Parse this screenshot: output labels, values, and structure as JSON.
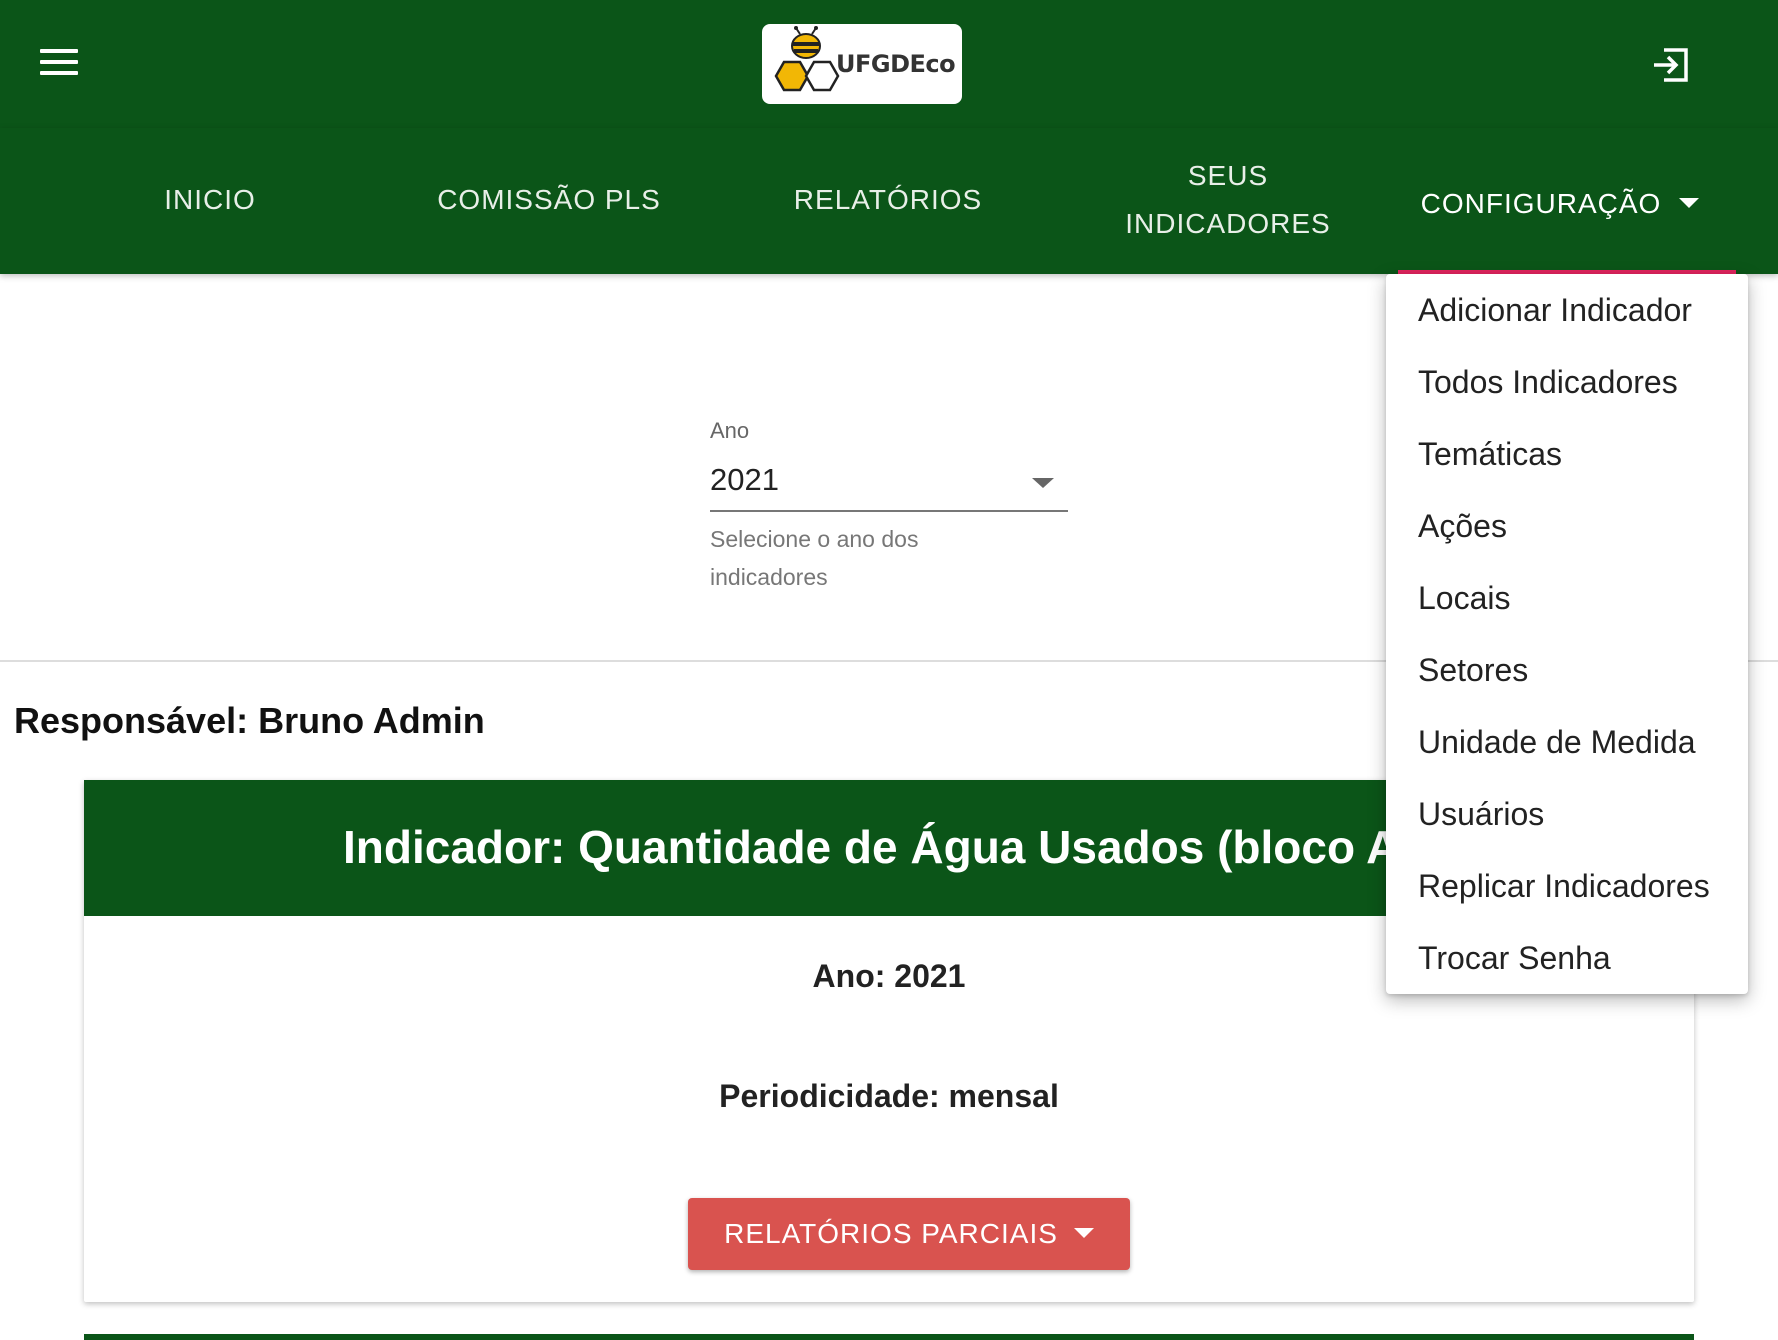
{
  "header": {
    "logo_text": "UFGDEco",
    "menu_icon": "hamburger-menu-icon",
    "exit_icon": "logout-icon"
  },
  "nav": {
    "items": [
      {
        "label": "INICIO"
      },
      {
        "label": "COMISSÃO PLS"
      },
      {
        "label": "RELATÓRIOS"
      },
      {
        "label_line1": "SEUS",
        "label_line2": "INDICADORES"
      },
      {
        "label": "CONFIGURAÇÃO"
      }
    ]
  },
  "config_menu": {
    "items": [
      "Adicionar Indicador",
      "Todos Indicadores",
      "Temáticas",
      "Ações",
      "Locais",
      "Setores",
      "Unidade de Medida",
      "Usuários",
      "Replicar Indicadores",
      "Trocar Senha"
    ]
  },
  "year_filter": {
    "label": "Ano",
    "value": "2021",
    "hint": "Selecione o ano dos indicadores"
  },
  "responsavel": "Responsável: Bruno Admin",
  "indicator_card": {
    "title": "Indicador: Quantidade de Água Usados (bloco A)",
    "ano": "Ano: 2021",
    "periodicidade": "Periodicidade: mensal",
    "button_label": "RELATÓRIOS PARCIAIS"
  },
  "colors": {
    "primary_green": "#0b5518",
    "accent_pink": "#e0245e",
    "button_red": "#d9534f"
  }
}
